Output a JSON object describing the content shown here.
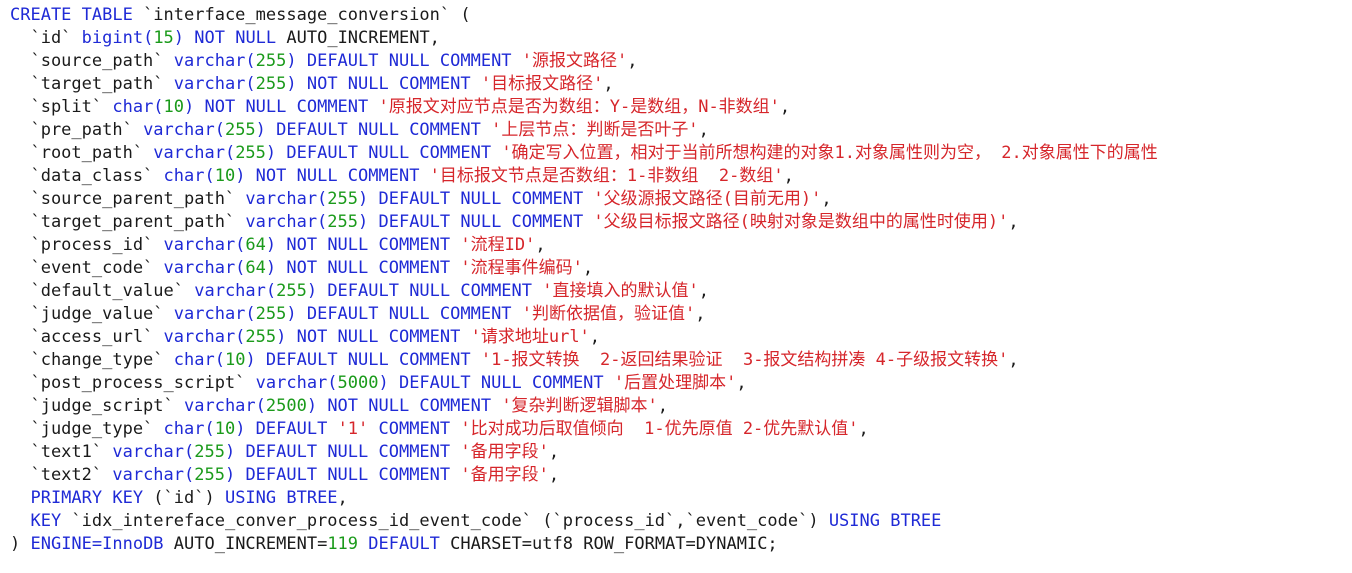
{
  "colors": {
    "keyword": "#1f2ad6",
    "number": "#1a9a1a",
    "string": "#d6262b",
    "text": "#1a1a1a",
    "background": "#ffffff"
  },
  "lines": [
    [
      {
        "t": "CREATE TABLE",
        "c": "kw"
      },
      {
        "t": " `interface_message_conversion` (",
        "c": "pl"
      }
    ],
    [
      {
        "t": "  `id` ",
        "c": "pl"
      },
      {
        "t": "bigint(",
        "c": "kw"
      },
      {
        "t": "15",
        "c": "num"
      },
      {
        "t": ") NOT NULL ",
        "c": "kw"
      },
      {
        "t": "AUTO_INCREMENT,",
        "c": "pl"
      }
    ],
    [
      {
        "t": "  `source_path` ",
        "c": "pl"
      },
      {
        "t": "varchar(",
        "c": "kw"
      },
      {
        "t": "255",
        "c": "num"
      },
      {
        "t": ") DEFAULT NULL COMMENT ",
        "c": "kw"
      },
      {
        "t": "'源报文路径'",
        "c": "str"
      },
      {
        "t": ",",
        "c": "pl"
      }
    ],
    [
      {
        "t": "  `target_path` ",
        "c": "pl"
      },
      {
        "t": "varchar(",
        "c": "kw"
      },
      {
        "t": "255",
        "c": "num"
      },
      {
        "t": ") NOT NULL COMMENT ",
        "c": "kw"
      },
      {
        "t": "'目标报文路径'",
        "c": "str"
      },
      {
        "t": ",",
        "c": "pl"
      }
    ],
    [
      {
        "t": "  `split` ",
        "c": "pl"
      },
      {
        "t": "char(",
        "c": "kw"
      },
      {
        "t": "10",
        "c": "num"
      },
      {
        "t": ") NOT NULL COMMENT ",
        "c": "kw"
      },
      {
        "t": "'原报文对应节点是否为数组：Y-是数组，N-非数组'",
        "c": "str"
      },
      {
        "t": ",",
        "c": "pl"
      }
    ],
    [
      {
        "t": "  `pre_path` ",
        "c": "pl"
      },
      {
        "t": "varchar(",
        "c": "kw"
      },
      {
        "t": "255",
        "c": "num"
      },
      {
        "t": ") DEFAULT NULL COMMENT ",
        "c": "kw"
      },
      {
        "t": "'上层节点：判断是否叶子'",
        "c": "str"
      },
      {
        "t": ",",
        "c": "pl"
      }
    ],
    [
      {
        "t": "  `root_path` ",
        "c": "pl"
      },
      {
        "t": "varchar(",
        "c": "kw"
      },
      {
        "t": "255",
        "c": "num"
      },
      {
        "t": ") DEFAULT NULL COMMENT ",
        "c": "kw"
      },
      {
        "t": "'确定写入位置，相对于当前所想构建的对象1.对象属性则为空， 2.对象属性下的属性",
        "c": "str"
      }
    ],
    [
      {
        "t": "  `data_class` ",
        "c": "pl"
      },
      {
        "t": "char(",
        "c": "kw"
      },
      {
        "t": "10",
        "c": "num"
      },
      {
        "t": ") NOT NULL COMMENT ",
        "c": "kw"
      },
      {
        "t": "'目标报文节点是否数组：1-非数组  2-数组'",
        "c": "str"
      },
      {
        "t": ",",
        "c": "pl"
      }
    ],
    [
      {
        "t": "  `source_parent_path` ",
        "c": "pl"
      },
      {
        "t": "varchar(",
        "c": "kw"
      },
      {
        "t": "255",
        "c": "num"
      },
      {
        "t": ") DEFAULT NULL COMMENT ",
        "c": "kw"
      },
      {
        "t": "'父级源报文路径(目前无用)'",
        "c": "str"
      },
      {
        "t": ",",
        "c": "pl"
      }
    ],
    [
      {
        "t": "  `target_parent_path` ",
        "c": "pl"
      },
      {
        "t": "varchar(",
        "c": "kw"
      },
      {
        "t": "255",
        "c": "num"
      },
      {
        "t": ") DEFAULT NULL COMMENT ",
        "c": "kw"
      },
      {
        "t": "'父级目标报文路径(映射对象是数组中的属性时使用)'",
        "c": "str"
      },
      {
        "t": ",",
        "c": "pl"
      }
    ],
    [
      {
        "t": "  `process_id` ",
        "c": "pl"
      },
      {
        "t": "varchar(",
        "c": "kw"
      },
      {
        "t": "64",
        "c": "num"
      },
      {
        "t": ") NOT NULL COMMENT ",
        "c": "kw"
      },
      {
        "t": "'流程ID'",
        "c": "str"
      },
      {
        "t": ",",
        "c": "pl"
      }
    ],
    [
      {
        "t": "  `event_code` ",
        "c": "pl"
      },
      {
        "t": "varchar(",
        "c": "kw"
      },
      {
        "t": "64",
        "c": "num"
      },
      {
        "t": ") NOT NULL COMMENT ",
        "c": "kw"
      },
      {
        "t": "'流程事件编码'",
        "c": "str"
      },
      {
        "t": ",",
        "c": "pl"
      }
    ],
    [
      {
        "t": "  `default_value` ",
        "c": "pl"
      },
      {
        "t": "varchar(",
        "c": "kw"
      },
      {
        "t": "255",
        "c": "num"
      },
      {
        "t": ") DEFAULT NULL COMMENT ",
        "c": "kw"
      },
      {
        "t": "'直接填入的默认值'",
        "c": "str"
      },
      {
        "t": ",",
        "c": "pl"
      }
    ],
    [
      {
        "t": "  `judge_value` ",
        "c": "pl"
      },
      {
        "t": "varchar(",
        "c": "kw"
      },
      {
        "t": "255",
        "c": "num"
      },
      {
        "t": ") DEFAULT NULL COMMENT ",
        "c": "kw"
      },
      {
        "t": "'判断依据值，验证值'",
        "c": "str"
      },
      {
        "t": ",",
        "c": "pl"
      }
    ],
    [
      {
        "t": "  `access_url` ",
        "c": "pl"
      },
      {
        "t": "varchar(",
        "c": "kw"
      },
      {
        "t": "255",
        "c": "num"
      },
      {
        "t": ") NOT NULL COMMENT ",
        "c": "kw"
      },
      {
        "t": "'请求地址url'",
        "c": "str"
      },
      {
        "t": ",",
        "c": "pl"
      }
    ],
    [
      {
        "t": "  `change_type` ",
        "c": "pl"
      },
      {
        "t": "char(",
        "c": "kw"
      },
      {
        "t": "10",
        "c": "num"
      },
      {
        "t": ") DEFAULT NULL COMMENT ",
        "c": "kw"
      },
      {
        "t": "'1-报文转换  2-返回结果验证  3-报文结构拼凑 4-子级报文转换'",
        "c": "str"
      },
      {
        "t": ",",
        "c": "pl"
      }
    ],
    [
      {
        "t": "  `post_process_script` ",
        "c": "pl"
      },
      {
        "t": "varchar(",
        "c": "kw"
      },
      {
        "t": "5000",
        "c": "num"
      },
      {
        "t": ") DEFAULT NULL COMMENT ",
        "c": "kw"
      },
      {
        "t": "'后置处理脚本'",
        "c": "str"
      },
      {
        "t": ",",
        "c": "pl"
      }
    ],
    [
      {
        "t": "  `judge_script` ",
        "c": "pl"
      },
      {
        "t": "varchar(",
        "c": "kw"
      },
      {
        "t": "2500",
        "c": "num"
      },
      {
        "t": ") NOT NULL COMMENT ",
        "c": "kw"
      },
      {
        "t": "'复杂判断逻辑脚本'",
        "c": "str"
      },
      {
        "t": ",",
        "c": "pl"
      }
    ],
    [
      {
        "t": "  `judge_type` ",
        "c": "pl"
      },
      {
        "t": "char(",
        "c": "kw"
      },
      {
        "t": "10",
        "c": "num"
      },
      {
        "t": ") DEFAULT ",
        "c": "kw"
      },
      {
        "t": "'1'",
        "c": "str"
      },
      {
        "t": " COMMENT ",
        "c": "kw"
      },
      {
        "t": "'比对成功后取值倾向  1-优先原值 2-优先默认值'",
        "c": "str"
      },
      {
        "t": ",",
        "c": "pl"
      }
    ],
    [
      {
        "t": "  `text1` ",
        "c": "pl"
      },
      {
        "t": "varchar(",
        "c": "kw"
      },
      {
        "t": "255",
        "c": "num"
      },
      {
        "t": ") DEFAULT NULL COMMENT ",
        "c": "kw"
      },
      {
        "t": "'备用字段'",
        "c": "str"
      },
      {
        "t": ",",
        "c": "pl"
      }
    ],
    [
      {
        "t": "  `text2` ",
        "c": "pl"
      },
      {
        "t": "varchar(",
        "c": "kw"
      },
      {
        "t": "255",
        "c": "num"
      },
      {
        "t": ") DEFAULT NULL COMMENT ",
        "c": "kw"
      },
      {
        "t": "'备用字段'",
        "c": "str"
      },
      {
        "t": ",",
        "c": "pl"
      }
    ],
    [
      {
        "t": "  PRIMARY KEY ",
        "c": "kw"
      },
      {
        "t": "(`id`) ",
        "c": "pl"
      },
      {
        "t": "USING BTREE",
        "c": "kw"
      },
      {
        "t": ",",
        "c": "pl"
      }
    ],
    [
      {
        "t": "  KEY ",
        "c": "kw"
      },
      {
        "t": "`idx_intereface_conver_process_id_event_code` (`process_id`,`event_code`) ",
        "c": "pl"
      },
      {
        "t": "USING BTREE",
        "c": "kw"
      }
    ],
    [
      {
        "t": ") ",
        "c": "pl"
      },
      {
        "t": "ENGINE=InnoDB ",
        "c": "kw"
      },
      {
        "t": "AUTO_INCREMENT=",
        "c": "pl"
      },
      {
        "t": "119",
        "c": "num"
      },
      {
        "t": " DEFAULT ",
        "c": "kw"
      },
      {
        "t": "CHARSET=utf8 ROW_FORMAT=DYNAMIC;",
        "c": "pl"
      }
    ]
  ]
}
